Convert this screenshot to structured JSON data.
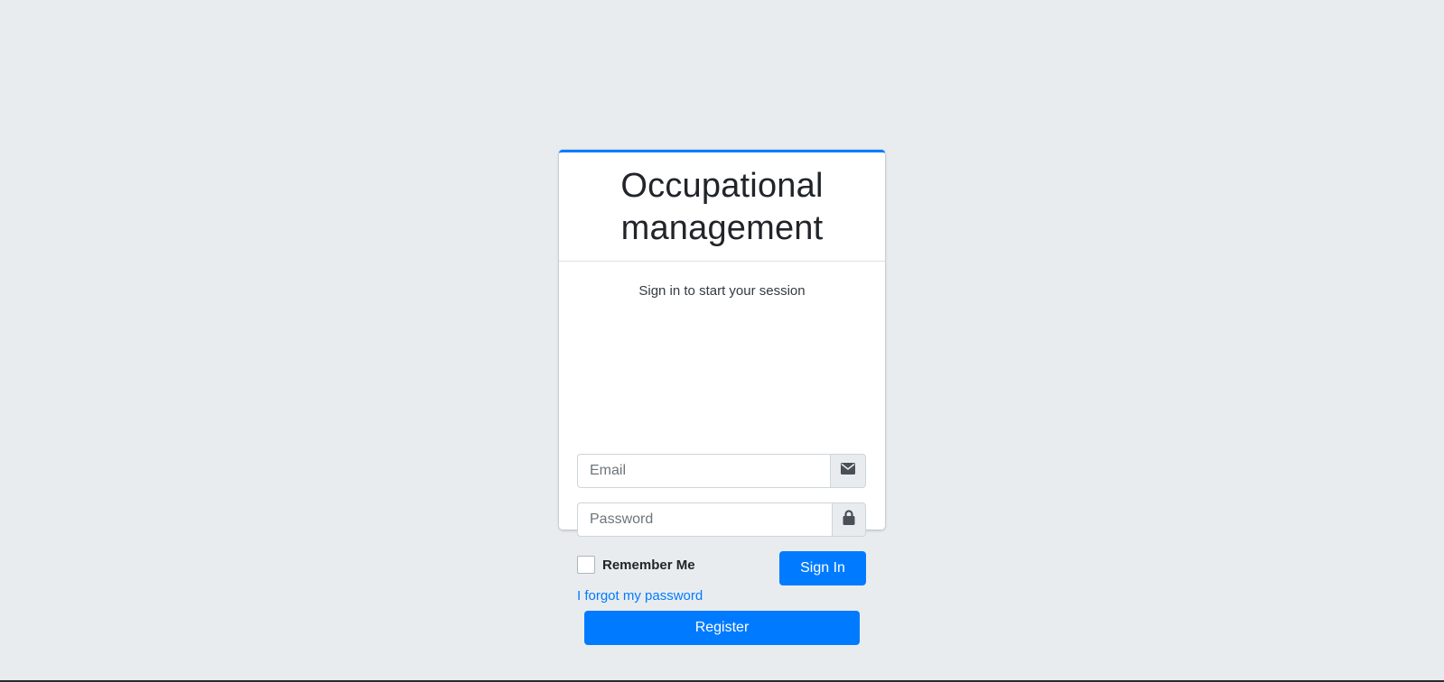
{
  "app": {
    "title": "Occupational management"
  },
  "login": {
    "subtitle": "Sign in to start your session",
    "email_placeholder": "Email",
    "password_placeholder": "Password",
    "remember_label": "Remember Me",
    "remember_checked": false,
    "signin_label": "Sign In",
    "forgot_label": "I forgot my password",
    "register_label": "Register"
  },
  "icons": {
    "email": "envelope-icon",
    "password": "lock-icon"
  },
  "colors": {
    "background": "#e9ecef",
    "primary": "#007bff",
    "card": "#ffffff",
    "text": "#212529"
  }
}
